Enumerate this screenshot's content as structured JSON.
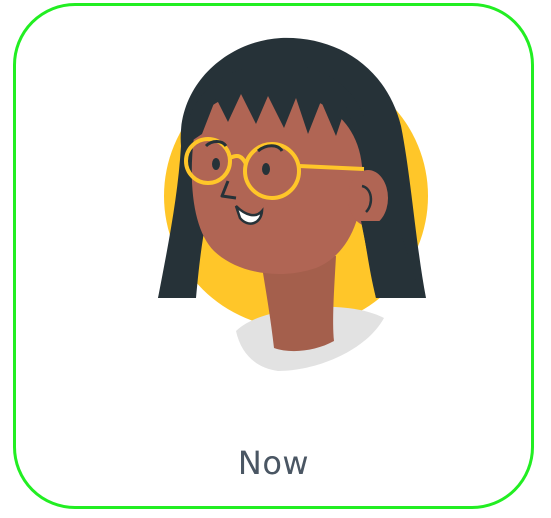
{
  "card": {
    "label": "Now",
    "avatar_icon": "woman-with-glasses-avatar-icon",
    "border_color": "#22ee22",
    "label_color": "#4a5663"
  }
}
